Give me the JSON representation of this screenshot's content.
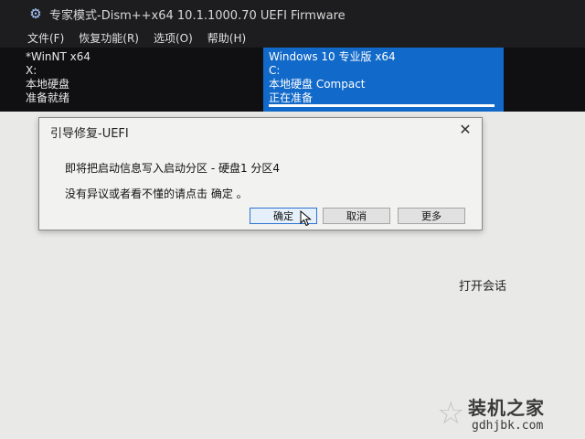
{
  "window": {
    "title": "专家模式-Dism++x64 10.1.1000.70 UEFI Firmware",
    "icon": "gear-icon"
  },
  "menu": [
    {
      "label": "文件(F)"
    },
    {
      "label": "恢复功能(R)"
    },
    {
      "label": "选项(O)"
    },
    {
      "label": "帮助(H)"
    }
  ],
  "sessions": {
    "left": {
      "name": "*WinNT x64",
      "drive": "X:",
      "disk": "本地硬盘",
      "status": "准备就绪"
    },
    "right": {
      "name": "Windows 10 专业版 x64",
      "drive": "C:",
      "disk": "本地硬盘 Compact",
      "status": "正在准备",
      "progress": 1.0
    }
  },
  "dialog": {
    "title": "引导修复-UEFI",
    "message1": "即将把启动信息写入启动分区 - 硬盘1 分区4",
    "message2": "没有异议或者看不懂的请点击 确定 。",
    "ok_label": "确定",
    "cancel_label": "取消",
    "more_label": "更多"
  },
  "main": {
    "open_session_label": "打开会话"
  },
  "watermark": {
    "title": "装机之家",
    "url": "gdhjbk.com"
  },
  "colors": {
    "selected_session": "#1169c9",
    "title_bar": "#1d1d1f",
    "dialog_bg": "#f2f2f0"
  }
}
